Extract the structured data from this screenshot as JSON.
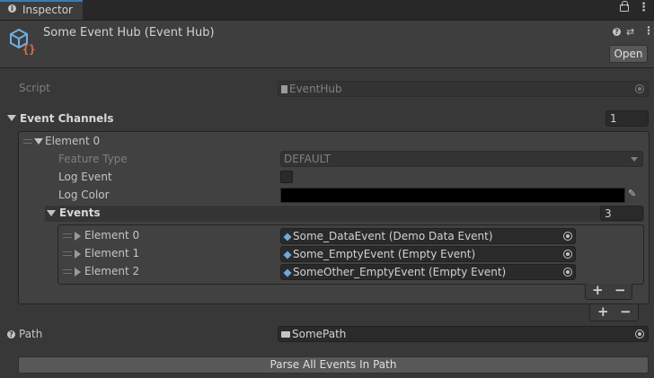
{
  "tab": {
    "label": "Inspector"
  },
  "header": {
    "title": "Some Event Hub (Event Hub)",
    "open_label": "Open"
  },
  "script": {
    "label": "Script",
    "value": "EventHub"
  },
  "event_channels": {
    "label": "Event Channels",
    "count": "1",
    "element": {
      "label": "Element 0",
      "feature_type_label": "Feature Type",
      "feature_type_value": "DEFAULT",
      "log_event_label": "Log Event",
      "log_color_label": "Log Color",
      "log_color": "#000000",
      "events": {
        "label": "Events",
        "count": "3",
        "items": [
          {
            "label": "Element 0",
            "value": "Some_DataEvent (Demo Data Event)"
          },
          {
            "label": "Element 1",
            "value": "Some_EmptyEvent (Empty Event)"
          },
          {
            "label": "Element 2",
            "value": "SomeOther_EmptyEvent (Empty Event)"
          }
        ]
      }
    }
  },
  "path": {
    "label": "Path",
    "value": "SomePath"
  },
  "parse_button": {
    "label": "Parse All Events In Path"
  },
  "icons": [
    "info-icon",
    "lock-icon",
    "menu-icon",
    "event-hub-icon",
    "help-icon",
    "preset-icon",
    "file-icon",
    "object-picker-icon",
    "foldout-arrow-icon",
    "drag-handle-icon",
    "dropdown-arrow-icon",
    "eyedropper-icon",
    "cube-icon",
    "folder-icon"
  ]
}
